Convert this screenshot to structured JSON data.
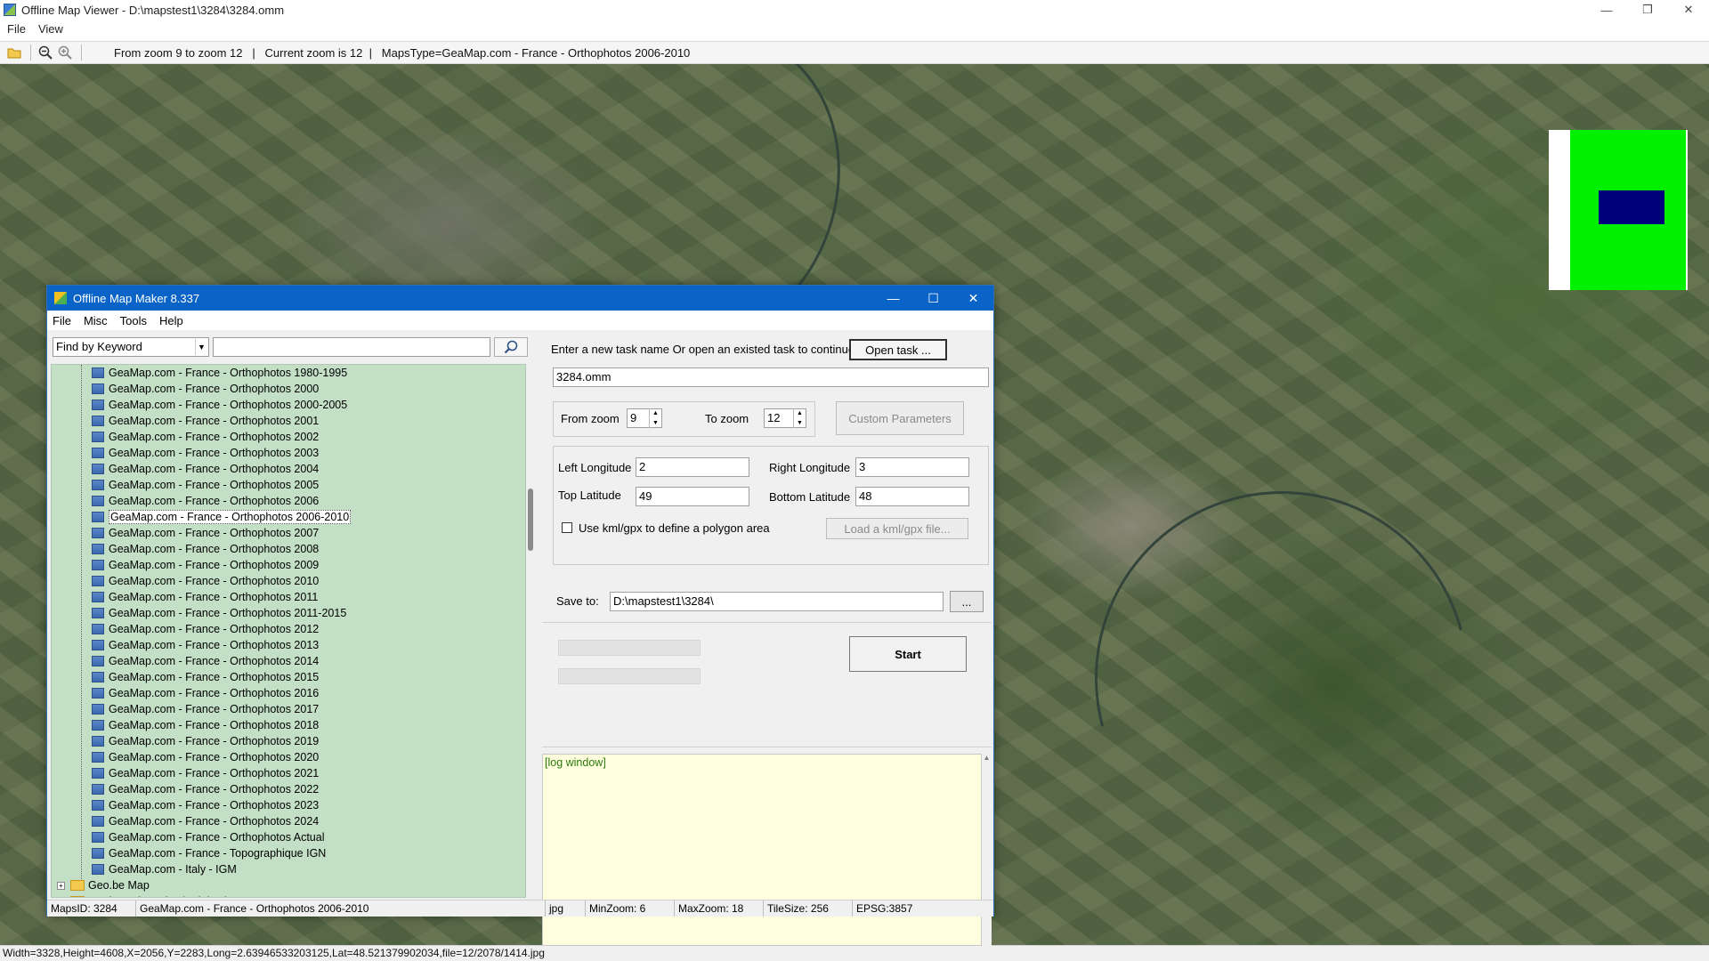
{
  "window": {
    "title": "Offline Map Viewer - D:\\mapstest1\\3284\\3284.omm",
    "controls": {
      "minimize": "—",
      "restore": "❐",
      "close": "✕"
    }
  },
  "menu": [
    "File",
    "View"
  ],
  "toolbar": {
    "zoom_range": "From zoom 9 to zoom 12   |   Current zoom is 12  |   MapsType=GeaMap.com - France - Orthophotos 2006-2010"
  },
  "status": "Width=3328,Height=4608,X=2056,Y=2283,Long=2.639465332031​25,Lat=48.521379902034,file=12/2078/1414.jpg",
  "dialog": {
    "title": "Offline Map Maker 8.337",
    "menu": [
      "File",
      "Misc",
      "Tools",
      "Help"
    ],
    "search": {
      "mode": "Find by Keyword",
      "keyword": ""
    },
    "tree_items": [
      "GeaMap.com - France - Orthophotos 1980-1995",
      "GeaMap.com - France - Orthophotos 2000",
      "GeaMap.com - France - Orthophotos 2000-2005",
      "GeaMap.com - France - Orthophotos 2001",
      "GeaMap.com - France - Orthophotos 2002",
      "GeaMap.com - France - Orthophotos 2003",
      "GeaMap.com - France - Orthophotos 2004",
      "GeaMap.com - France - Orthophotos 2005",
      "GeaMap.com - France - Orthophotos 2006",
      "GeaMap.com - France - Orthophotos 2006-2010",
      "GeaMap.com - France - Orthophotos 2007",
      "GeaMap.com - France - Orthophotos 2008",
      "GeaMap.com - France - Orthophotos 2009",
      "GeaMap.com - France - Orthophotos 2010",
      "GeaMap.com - France - Orthophotos 2011",
      "GeaMap.com - France - Orthophotos 2011-2015",
      "GeaMap.com - France - Orthophotos 2012",
      "GeaMap.com - France - Orthophotos 2013",
      "GeaMap.com - France - Orthophotos 2014",
      "GeaMap.com - France - Orthophotos 2015",
      "GeaMap.com - France - Orthophotos 2016",
      "GeaMap.com - France - Orthophotos 2017",
      "GeaMap.com - France - Orthophotos 2018",
      "GeaMap.com - France - Orthophotos 2019",
      "GeaMap.com - France - Orthophotos 2020",
      "GeaMap.com - France - Orthophotos 2021",
      "GeaMap.com - France - Orthophotos 2022",
      "GeaMap.com - France - Orthophotos 2023",
      "GeaMap.com - France - Orthophotos 2024",
      "GeaMap.com - France - Orthophotos Actual",
      "GeaMap.com - France - Topographique IGN",
      "GeaMap.com - Italy - IGM"
    ],
    "selected_item": "GeaMap.com - France - Orthophotos 2006-2010",
    "tree_folders": [
      "Geo.be Map",
      "Geobox.wiaaat.be (Belgium)"
    ],
    "task": {
      "prompt": "Enter a new task name Or open an existed task to continue:",
      "open_button": "Open task ...",
      "name": "3284.omm"
    },
    "zoom": {
      "from_label": "From zoom",
      "from_value": "9",
      "to_label": "To zoom",
      "to_value": "12",
      "custom_button": "Custom Parameters"
    },
    "coords": {
      "left_lon_label": "Left Longitude",
      "left_lon": "2",
      "right_lon_label": "Right Longitude",
      "right_lon": "3",
      "top_lat_label": "Top Latitude",
      "top_lat": "49",
      "bottom_lat_label": "Bottom Latitude",
      "bottom_lat": "48",
      "kml_label": "Use kml/gpx to define a polygon area",
      "kml_button": "Load a kml/gpx file..."
    },
    "save": {
      "label": "Save to:",
      "path": "D:\\mapstest1\\3284\\",
      "browse": "..."
    },
    "start_button": "Start",
    "log": "[log window]",
    "status": {
      "maps_id": "MapsID: 3284",
      "map_name": "GeaMap.com - France - Orthophotos 2006-2010",
      "format": "jpg",
      "min_zoom": "MinZoom: 6",
      "max_zoom": "MaxZoom: 18",
      "tile_size": "TileSize: 256",
      "epsg": "EPSG:3857"
    }
  }
}
